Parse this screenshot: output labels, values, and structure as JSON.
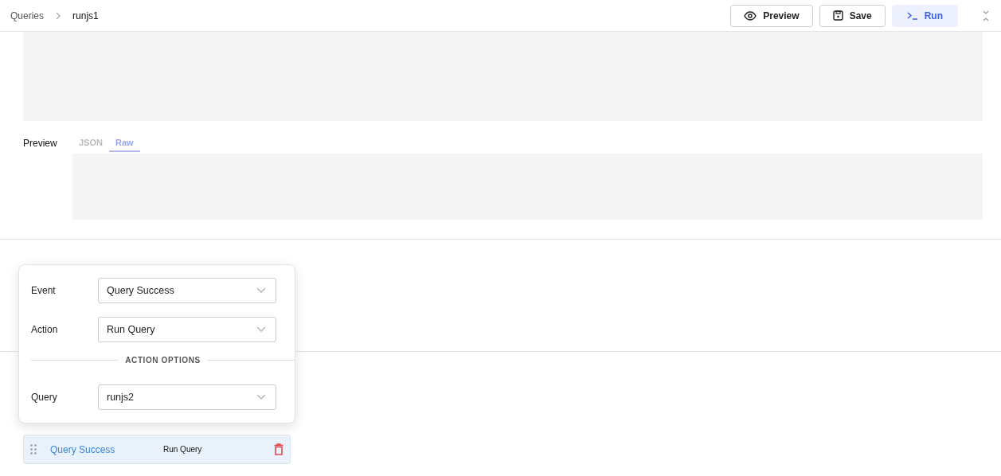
{
  "breadcrumb": {
    "parent": "Queries",
    "current": "runjs1"
  },
  "toolbar": [
    {
      "label": "Preview",
      "kind": "preview"
    },
    {
      "label": "Save",
      "kind": "save"
    },
    {
      "label": "Run",
      "kind": "run"
    }
  ],
  "preview": {
    "label": "Preview",
    "tabs": [
      {
        "label": "JSON",
        "selected": false
      },
      {
        "label": "Raw",
        "selected": true
      }
    ]
  },
  "event_row": {
    "event": "Query Success",
    "action": "Run Query"
  },
  "popover": {
    "fields": [
      {
        "label": "Event",
        "value": "Query Success"
      },
      {
        "label": "Action",
        "value": "Run Query"
      }
    ],
    "section": "ACTION OPTIONS",
    "options": [
      {
        "label": "Query",
        "value": "runjs2"
      }
    ]
  }
}
